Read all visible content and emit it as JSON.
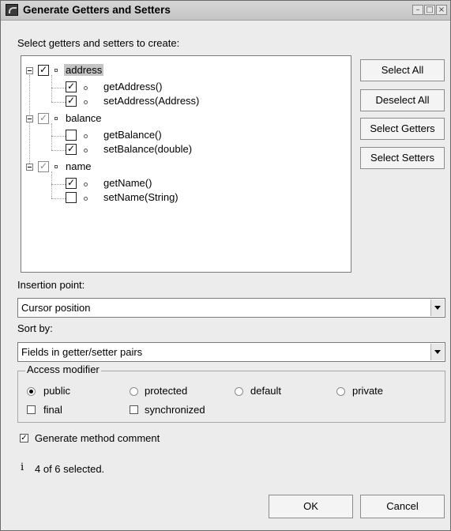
{
  "window": {
    "title": "Generate Getters and Setters",
    "controls": [
      "minimize-icon",
      "maximize-icon",
      "close-icon"
    ]
  },
  "instructions": "Select getters and setters to create:",
  "tree": [
    {
      "label": "address",
      "checked": true,
      "grayed": false,
      "selected": true,
      "children": [
        {
          "label": "getAddress()",
          "checked": true
        },
        {
          "label": "setAddress(Address)",
          "checked": true
        }
      ]
    },
    {
      "label": "balance",
      "checked": true,
      "grayed": true,
      "selected": false,
      "children": [
        {
          "label": "getBalance()",
          "checked": false
        },
        {
          "label": "setBalance(double)",
          "checked": true
        }
      ]
    },
    {
      "label": "name",
      "checked": true,
      "grayed": true,
      "selected": false,
      "children": [
        {
          "label": "getName()",
          "checked": true
        },
        {
          "label": "setName(String)",
          "checked": false
        }
      ]
    }
  ],
  "side_buttons": {
    "select_all": "Select All",
    "deselect_all": "Deselect All",
    "select_getters": "Select Getters",
    "select_setters": "Select Setters"
  },
  "insertion": {
    "label": "Insertion point:",
    "value": "Cursor position"
  },
  "sort": {
    "label": "Sort by:",
    "value": "Fields in getter/setter pairs"
  },
  "access": {
    "legend": "Access modifier",
    "options": [
      {
        "label": "public",
        "checked": true
      },
      {
        "label": "protected",
        "checked": false
      },
      {
        "label": "default",
        "checked": false
      },
      {
        "label": "private",
        "checked": false
      }
    ],
    "final_label": "final",
    "synchronized_label": "synchronized"
  },
  "comment": {
    "label": "Generate method comment",
    "checked": true
  },
  "status": {
    "icon": "info-icon",
    "text": "4 of 6 selected."
  },
  "footer": {
    "ok": "OK",
    "cancel": "Cancel"
  },
  "colors": {
    "dialog_bg": "#ececec",
    "selection": "#c4c4c4"
  }
}
